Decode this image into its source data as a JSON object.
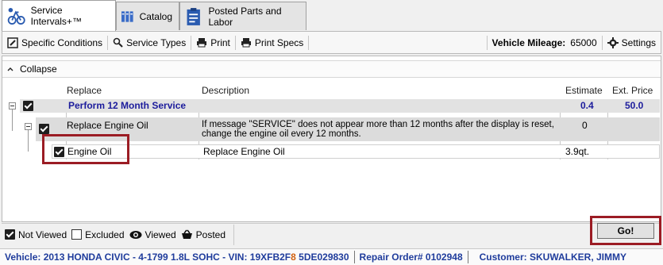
{
  "tabs": [
    {
      "label": "Service Intervals+™",
      "icon": "service-intervals-icon",
      "active": true
    },
    {
      "label": "Catalog",
      "icon": "catalog-icon",
      "active": false
    },
    {
      "label": "Posted Parts and Labor",
      "icon": "clipboard-icon",
      "active": false
    }
  ],
  "toolbar": {
    "specific_conditions": "Specific Conditions",
    "service_types": "Service Types",
    "print": "Print",
    "print_specs": "Print Specs",
    "mileage_label": "Vehicle Mileage:",
    "mileage_value": "65000",
    "settings": "Settings"
  },
  "collapse_label": "Collapse",
  "columns": {
    "replace": "Replace",
    "description": "Description",
    "estimate": "Estimate",
    "ext_price": "Ext. Price"
  },
  "service": {
    "title": "Perform 12 Month Service",
    "estimate": "0.4",
    "ext_price": "50.0"
  },
  "replace_row": {
    "title": "Replace Engine Oil",
    "description_line1": "If message \"SERVICE\" does not appear more than 12 months after the display is reset,",
    "description_line2": "change the engine oil every 12 months.",
    "estimate": "0"
  },
  "part_row": {
    "title": "Engine Oil",
    "description": "Replace Engine Oil",
    "estimate": "3.9qt."
  },
  "legend": {
    "not_viewed": "Not Viewed",
    "excluded": "Excluded",
    "viewed": "Viewed",
    "posted": "Posted"
  },
  "go_label": "Go!",
  "status": {
    "vehicle_prefix": "Vehicle: 2013 HONDA CIVIC - 4-1799 1.8L SOHC - VIN: 19XFB2F",
    "vin_highlight": "8",
    "vin_suffix": " 5DE029830",
    "repair_order": "Repair Order# 0102948",
    "customer": "Customer: SKUWALKER, JIMMY"
  },
  "colors": {
    "accent_blue": "#1c1c9c",
    "highlight_red": "#9b1c24",
    "status_blue": "#1f3c9c",
    "vin_orange": "#d06010"
  }
}
